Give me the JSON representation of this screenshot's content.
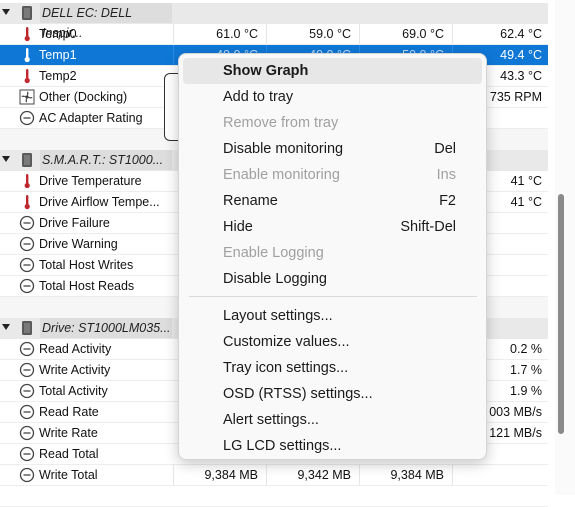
{
  "groups": {
    "dell": "DELL EC: DELL Inspir...",
    "smart": "S.M.A.R.T.: ST1000...",
    "drive": "Drive: ST1000LM035..."
  },
  "rows": {
    "temp0": {
      "label": "Temp0",
      "v1": "61.0 °C",
      "v2": "59.0 °C",
      "v3": "69.0 °C",
      "v4": "62.4 °C"
    },
    "temp1": {
      "label": "Temp1",
      "v1": "49.0 °C",
      "v2": "49.0 °C",
      "v3": "50.0 °C",
      "v4": "49.4 °C"
    },
    "temp2": {
      "label": "Temp2",
      "v4": "43.3 °C"
    },
    "other_docking": {
      "label": "Other (Docking)",
      "v4": "735 RPM"
    },
    "ac_adapter": {
      "label": "AC Adapter Rating"
    },
    "drive_temp": {
      "label": "Drive Temperature",
      "v4": "41 °C"
    },
    "drive_airflow": {
      "label": "Drive Airflow Tempe...",
      "v4": "41 °C"
    },
    "drive_failure": {
      "label": "Drive Failure"
    },
    "drive_warning": {
      "label": "Drive Warning"
    },
    "host_writes": {
      "label": "Total Host Writes"
    },
    "host_reads": {
      "label": "Total Host Reads"
    },
    "read_activity": {
      "label": "Read Activity",
      "v4": "0.2 %"
    },
    "write_activity": {
      "label": "Write Activity",
      "v4": "1.7 %"
    },
    "total_activity": {
      "label": "Total Activity",
      "v4": "1.9 %"
    },
    "read_rate": {
      "label": "Read Rate",
      "v4": "003 MB/s"
    },
    "write_rate": {
      "label": "Write Rate",
      "v4": "121 MB/s"
    },
    "read_total": {
      "label": "Read Total"
    },
    "write_total": {
      "label": "Write Total",
      "v1": "9,384 MB",
      "v2": "9,342 MB",
      "v3": "9,384 MB",
      "v4": ""
    }
  },
  "menu": {
    "show_graph": "Show Graph",
    "add_to_tray": "Add to tray",
    "remove_from_tray": "Remove from tray",
    "disable_monitoring": "Disable monitoring",
    "disable_monitoring_key": "Del",
    "enable_monitoring": "Enable monitoring",
    "enable_monitoring_key": "Ins",
    "rename": "Rename",
    "rename_key": "F2",
    "hide": "Hide",
    "hide_key": "Shift-Del",
    "enable_logging": "Enable Logging",
    "disable_logging": "Disable Logging",
    "layout_settings": "Layout settings...",
    "customize_values": "Customize values...",
    "tray_icon_settings": "Tray icon settings...",
    "osd_settings": "OSD (RTSS) settings...",
    "alert_settings": "Alert settings...",
    "lg_lcd_settings": "LG LCD settings..."
  },
  "colors": {
    "selection": "#0f78d7",
    "thermometer": "#c0282d",
    "menu_bg": "#f9f9f9"
  },
  "icons": {
    "group": "chip-icon",
    "temperature": "thermometer-icon",
    "fan": "fan-icon",
    "other": "gauge-icon"
  }
}
